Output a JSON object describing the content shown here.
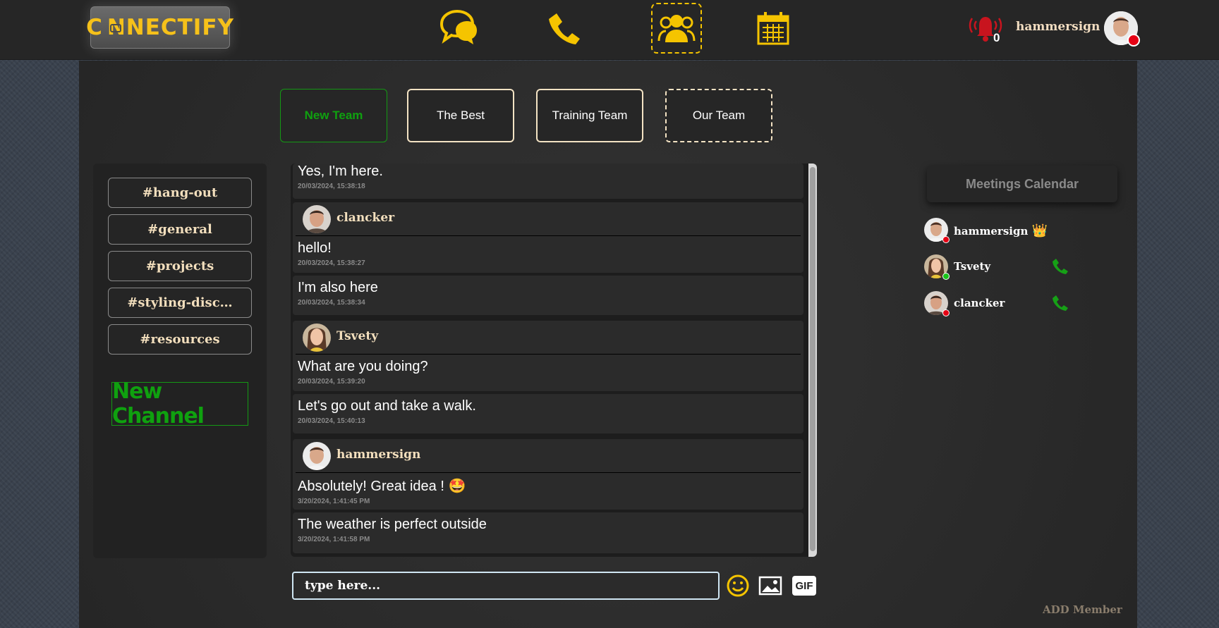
{
  "header": {
    "logo_text_left": "C",
    "logo_text_right": "NNECTIFY",
    "notification_count": "0",
    "username": "hammersign",
    "nav": [
      {
        "name": "chat",
        "icon": "chat-bubbles-icon"
      },
      {
        "name": "calls",
        "icon": "phone-icon"
      },
      {
        "name": "teams",
        "icon": "team-icon",
        "active": true
      },
      {
        "name": "calendar",
        "icon": "calendar-icon"
      }
    ]
  },
  "teams": {
    "tabs": [
      {
        "label": "New Team",
        "style": "selected"
      },
      {
        "label": "The Best",
        "style": "solid"
      },
      {
        "label": "Training Team",
        "style": "solid"
      },
      {
        "label": "Our Team",
        "style": "dashed"
      }
    ]
  },
  "channels": {
    "items": [
      "#hang-out",
      "#general",
      "#projects",
      "#styling-disc…",
      "#resources"
    ],
    "new_channel_label": "New Channel"
  },
  "chat": {
    "messages": [
      {
        "author": "",
        "text": "Yes, I'm here.",
        "time": "20/03/2024, 15:38:18"
      },
      {
        "author": "clancker",
        "text": "hello!",
        "time": "20/03/2024, 15:38:27"
      },
      {
        "author": "",
        "text": "I'm also here",
        "time": "20/03/2024, 15:38:34"
      },
      {
        "author": "Tsvety",
        "text": "What are you doing?",
        "time": "20/03/2024, 15:39:20"
      },
      {
        "author": "",
        "text": " Let's go out and take a walk.",
        "time": "20/03/2024, 15:40:13"
      },
      {
        "author": "hammersign",
        "text": "Absolutely! Great idea ! 🤩",
        "time": "3/20/2024, 1:41:45 PM"
      },
      {
        "author": "",
        "text": "The weather is perfect outside",
        "time": "3/20/2024, 1:41:58 PM"
      }
    ],
    "input_placeholder": "type here...",
    "gif_label": "GIF"
  },
  "sidebar_right": {
    "calendar_label": "Meetings Calendar",
    "members": [
      {
        "name": "hammersign",
        "status": "offline",
        "badge": "👑",
        "call": false
      },
      {
        "name": "Tsvety",
        "status": "online",
        "badge": "",
        "call": true
      },
      {
        "name": "clancker",
        "status": "offline",
        "badge": "",
        "call": true
      }
    ],
    "add_member_label": "ADD Member"
  },
  "colors": {
    "accent_yellow": "#f5c400",
    "accent_green": "#0fa10f",
    "status_red": "#e50014",
    "status_green": "#19c219",
    "text_cream": "#f3dfbd"
  }
}
